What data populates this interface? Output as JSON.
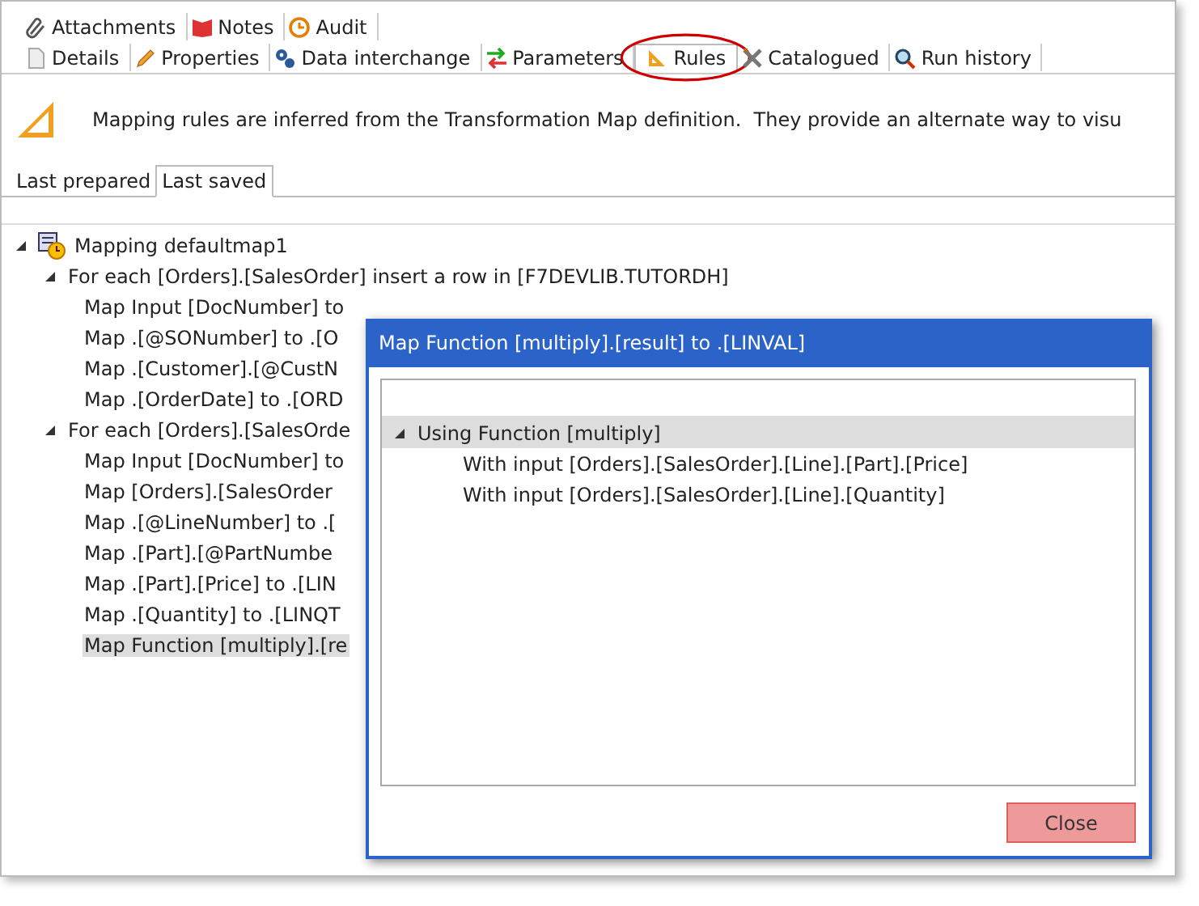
{
  "tab_rows": [
    [
      {
        "label": "Attachments",
        "selected": false
      },
      {
        "label": "Notes",
        "selected": false
      },
      {
        "label": "Audit",
        "selected": false
      }
    ],
    [
      {
        "label": "Details",
        "selected": false
      },
      {
        "label": "Properties",
        "selected": false
      },
      {
        "label": "Data interchange",
        "selected": false
      },
      {
        "label": "Parameters",
        "selected": false
      },
      {
        "label": "Rules",
        "selected": true
      },
      {
        "label": "Catalogued",
        "selected": false
      },
      {
        "label": "Run history",
        "selected": false
      }
    ]
  ],
  "info": "Mapping rules are inferred from the Transformation Map definition.  They provide an alternate way to visu",
  "sub_tabs": [
    {
      "label": "Last prepared",
      "selected": false
    },
    {
      "label": "Last saved",
      "selected": true
    }
  ],
  "tree": {
    "label": "Mapping defaultmap1",
    "expanded": true,
    "selected": false,
    "children": [
      {
        "label": "For each [Orders].[SalesOrder] insert a row in [F7DEVLIB.TUTORDH]",
        "expanded": true,
        "selected": false,
        "children": [
          {
            "label": "Map Input [DocNumber] to",
            "selected": false
          },
          {
            "label": "Map .[@SONumber] to .[O",
            "selected": false
          },
          {
            "label": "Map .[Customer].[@CustN",
            "selected": false
          },
          {
            "label": "Map .[OrderDate] to .[ORD",
            "selected": false
          }
        ]
      },
      {
        "label": "For each [Orders].[SalesOrde",
        "expanded": true,
        "selected": false,
        "children": [
          {
            "label": "Map Input [DocNumber] to",
            "selected": false
          },
          {
            "label": "Map [Orders].[SalesOrder",
            "selected": false
          },
          {
            "label": "Map .[@LineNumber] to .[",
            "selected": false
          },
          {
            "label": "Map .[Part].[@PartNumbe",
            "selected": false
          },
          {
            "label": "Map .[Part].[Price] to .[LIN",
            "selected": false
          },
          {
            "label": "Map .[Quantity] to .[LINQT",
            "selected": false
          },
          {
            "label": "Map Function [multiply].[re",
            "selected": true
          }
        ]
      }
    ]
  },
  "dialog": {
    "title": "Map Function [multiply].[result] to .[LINVAL]",
    "tree": [
      {
        "label": "Using Function [multiply]",
        "expanded": true,
        "selected": true,
        "children": [
          {
            "label": "With input [Orders].[SalesOrder].[Line].[Part].[Price]",
            "selected": false
          },
          {
            "label": "With input [Orders].[SalesOrder].[Line].[Quantity]",
            "selected": false
          }
        ]
      }
    ],
    "button": "Close"
  }
}
